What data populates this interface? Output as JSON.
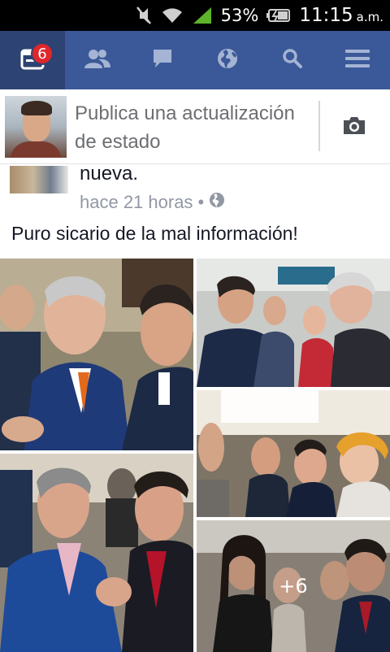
{
  "status_bar": {
    "battery_percent": "53%",
    "time": "11:15",
    "ampm": "a.m.",
    "icons": [
      "mute-icon",
      "wifi-icon",
      "signal-icon",
      "battery-icon"
    ]
  },
  "nav": {
    "items": [
      {
        "name": "news-feed",
        "icon": "news-feed-icon",
        "badge": "6",
        "active": true
      },
      {
        "name": "friend-requests",
        "icon": "friends-icon"
      },
      {
        "name": "messages",
        "icon": "chat-icon"
      },
      {
        "name": "notifications",
        "icon": "globe-icon"
      },
      {
        "name": "search",
        "icon": "search-icon"
      },
      {
        "name": "menu",
        "icon": "menu-icon"
      }
    ],
    "colors": {
      "bar": "#3b5998",
      "active": "#2d4373",
      "badge": "#e0262a"
    }
  },
  "composer": {
    "placeholder": "Publica una actualización de estado",
    "camera_icon": "camera-icon"
  },
  "post": {
    "headline_tail": "nueva.",
    "timestamp": "hace 21 horas",
    "separator": "•",
    "privacy_icon": "globe-icon",
    "text": "Puro sicario de la mal información!",
    "more_photos_label": "+6"
  }
}
